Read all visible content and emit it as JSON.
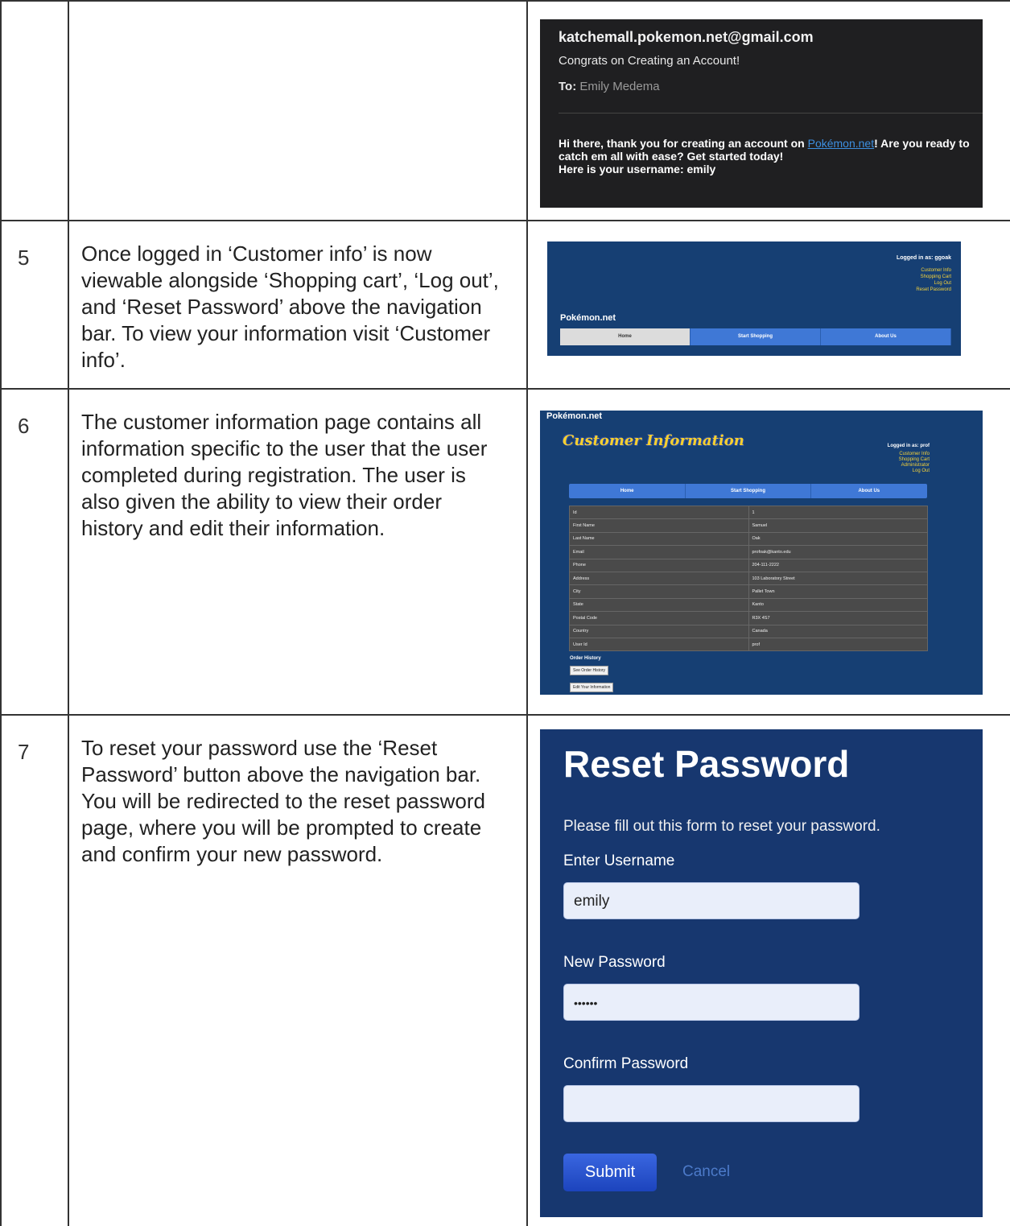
{
  "rows": [
    {
      "num": "",
      "desc": ""
    },
    {
      "num": "5",
      "desc": "Once logged in ‘Customer info’ is now viewable alongside ‘Shopping cart’, ‘Log out’, and ‘Reset Password’ above the navigation bar. To view your information visit ‘Customer info’."
    },
    {
      "num": "6",
      "desc": "The customer information page contains all information specific to the user that the user completed during registration. The user is also given the ability to view their order history and edit their information."
    },
    {
      "num": "7",
      "desc": "To reset your password use the ‘Reset Password’ button above the navigation bar. You will be redirected to the reset password page, where you will be prompted to create and confirm your new password."
    }
  ],
  "email": {
    "from": "katchemall.pokemon.net@gmail.com",
    "subject": "Congrats on Creating an Account!",
    "to_label": "To:",
    "to_name": "Emily Medema",
    "body_pre": "Hi there, thank you for creating an account on ",
    "body_link": "Pokémon.net",
    "body_post": "! Are you ready to catch em all with ease? Get started today!",
    "body_line2": "Here is your username: emily"
  },
  "nav_shot": {
    "logged_in": "Logged in as: ggoak",
    "links": [
      "Customer Info",
      "Shopping Cart",
      "Log Out",
      "Reset Password"
    ],
    "brand": "Pokémon.net",
    "nav": [
      "Home",
      "Start Shopping",
      "About Us"
    ]
  },
  "customer_shot": {
    "brand": "Pokémon.net",
    "title": "Customer Information",
    "logged_in": "Logged in as: prof",
    "links": [
      "Customer Info",
      "Shopping Cart",
      "Administrator",
      "Log Out"
    ],
    "nav": [
      "Home",
      "Start Shopping",
      "About Us"
    ],
    "fields": [
      [
        "Id",
        "1"
      ],
      [
        "First Name",
        "Samuel"
      ],
      [
        "Last Name",
        "Oak"
      ],
      [
        "Email",
        "profoak@kanto.edu"
      ],
      [
        "Phone",
        "204-111-2222"
      ],
      [
        "Address",
        "103 Laboratory Street"
      ],
      [
        "City",
        "Pallet Town"
      ],
      [
        "State",
        "Kanto"
      ],
      [
        "Postal Code",
        "R3X 4S7"
      ],
      [
        "Country",
        "Canada"
      ],
      [
        "User Id",
        "prof"
      ]
    ],
    "order_history": "Order History",
    "see_history_btn": "See Order History",
    "edit_btn": "Edit Your Information"
  },
  "reset_shot": {
    "heading": "Reset Password",
    "intro": "Please fill out this form to reset your password.",
    "username_label": "Enter Username",
    "username_value": "emily",
    "new_password_label": "New Password",
    "new_password_value": "••••••",
    "confirm_label": "Confirm Password",
    "confirm_value": "",
    "submit": "Submit",
    "cancel": "Cancel"
  }
}
